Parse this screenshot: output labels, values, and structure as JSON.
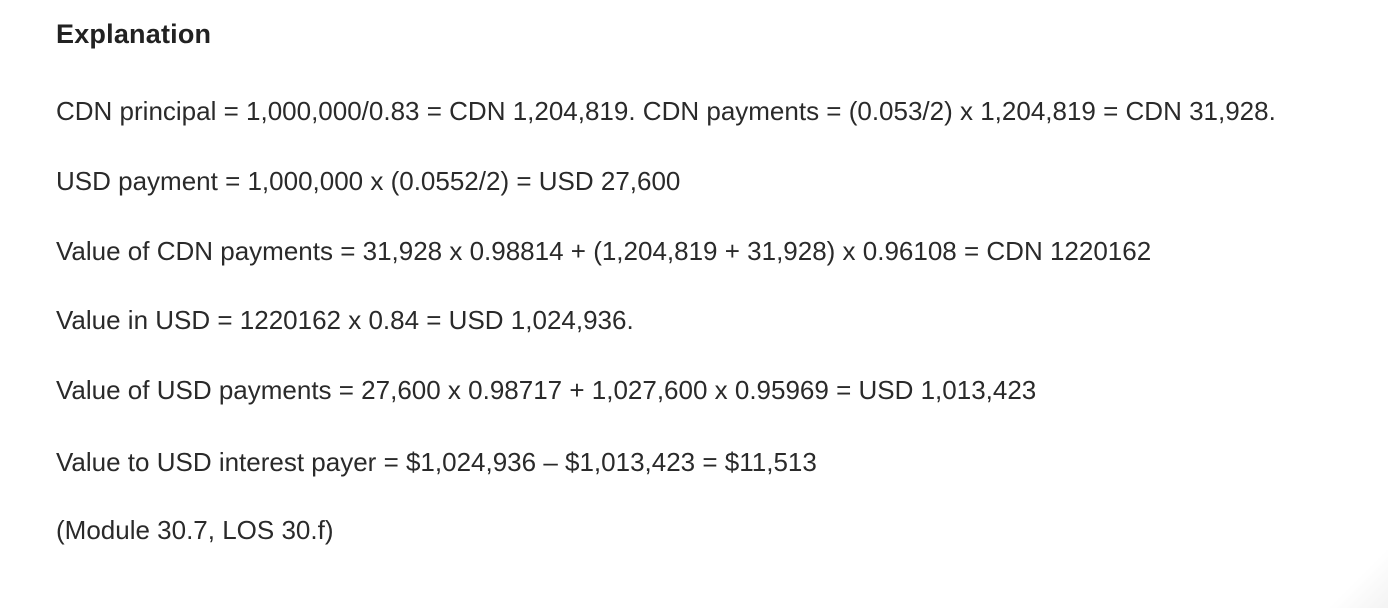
{
  "explanation": {
    "heading": "Explanation",
    "paragraphs": [
      "CDN principal = 1,000,000/0.83 = CDN 1,204,819. CDN payments = (0.053/2) x 1,204,819 = CDN 31,928.",
      "USD payment = 1,000,000 x (0.0552/2) = USD 27,600",
      "Value of CDN payments = 31,928 x 0.98814 + (1,204,819 + 31,928) x 0.96108 = CDN 1220162",
      "Value in USD = 1220162 x 0.84 = USD 1,024,936.",
      "Value of USD payments = 27,600 x 0.98717 + 1,027,600 x 0.95969 = USD 1,013,423",
      "Value to USD interest payer = $1,024,936 – $1,013,423 = $11,513",
      "(Module 30.7, LOS 30.f)"
    ]
  }
}
